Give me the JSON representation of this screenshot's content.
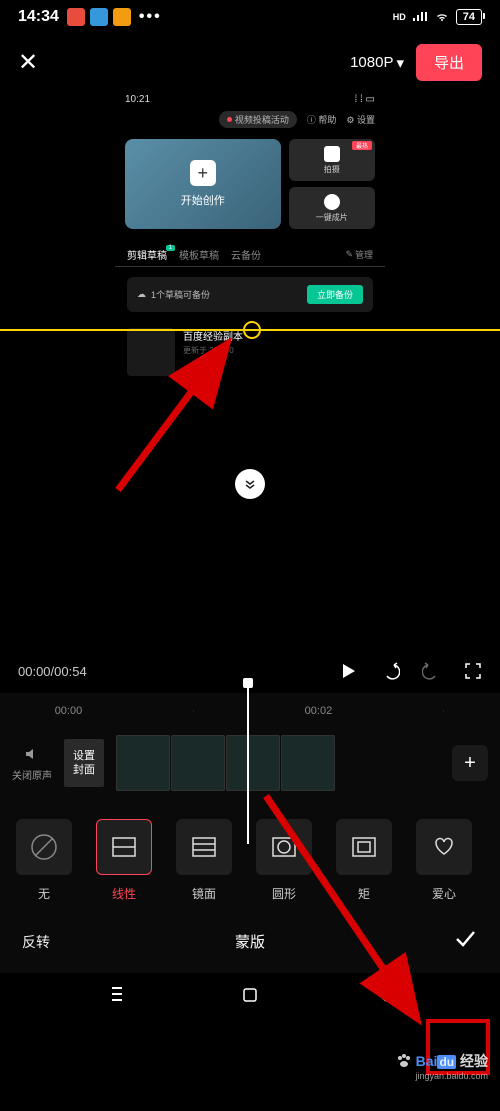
{
  "status_bar": {
    "time": "14:34",
    "battery": "74",
    "hd_label": "HD"
  },
  "top_bar": {
    "resolution": "1080P",
    "export_label": "导出"
  },
  "inner": {
    "status_time": "10:21",
    "activity_label": "视频投稿活动",
    "help_label": "帮助",
    "settings_label": "设置",
    "create_label": "开始创作",
    "shoot_label": "拍摄",
    "hot_badge": "最热",
    "oneclick_label": "一键成片",
    "tabs": [
      {
        "label": "剪辑草稿",
        "badge": "1"
      },
      {
        "label": "模板草稿"
      },
      {
        "label": "云备份"
      }
    ],
    "manage_label": "管理",
    "backup_text": "1个草稿可备份",
    "backup_btn": "立即备份",
    "draft_title": "百度经验副本",
    "draft_meta": "更新于 2021.0"
  },
  "playback": {
    "current_time": "00:00",
    "total_time": "00:54"
  },
  "timeline": {
    "ruler": [
      "00:00",
      "00:02"
    ],
    "mute_label": "关闭原声",
    "cover_label": "设置\n封面"
  },
  "mask_options": [
    {
      "id": "none",
      "label": "无"
    },
    {
      "id": "linear",
      "label": "线性",
      "selected": true
    },
    {
      "id": "mirror",
      "label": "镜面"
    },
    {
      "id": "circle",
      "label": "圆形"
    },
    {
      "id": "rect",
      "label": "矩"
    },
    {
      "id": "heart",
      "label": "爱心"
    }
  ],
  "bottom_bar": {
    "invert_label": "反转",
    "title": "蒙版"
  },
  "watermark": {
    "brand": "Baidu",
    "text": "经验",
    "url": "jingyan.baidu.com"
  }
}
